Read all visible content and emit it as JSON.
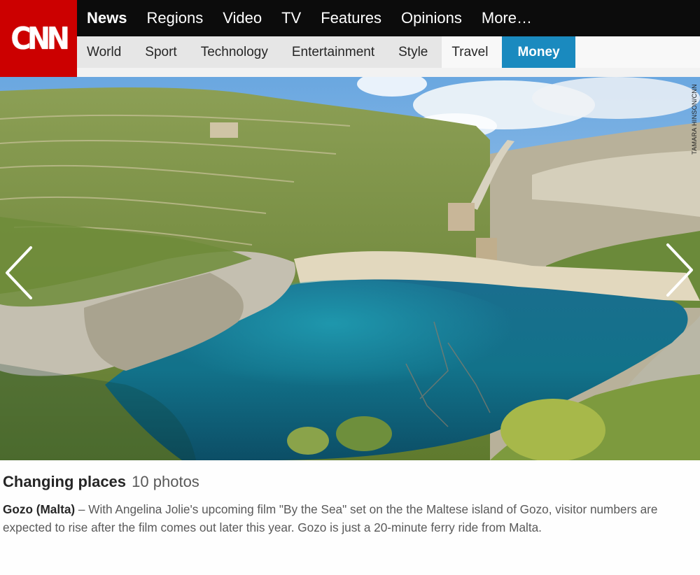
{
  "logo": {
    "text": "CNN"
  },
  "topnav": {
    "items": [
      "News",
      "Regions",
      "Video",
      "TV",
      "Features",
      "Opinions",
      "More…"
    ]
  },
  "subnav": {
    "items": [
      "World",
      "Sport",
      "Technology",
      "Entertainment",
      "Style",
      "Travel",
      "Money"
    ]
  },
  "photo": {
    "credit": "TAMARA HINSON/CNN",
    "prev_icon": "chevron-left-icon",
    "next_icon": "chevron-right-icon"
  },
  "gallery": {
    "title": "Changing places",
    "count": "10 photos"
  },
  "caption": {
    "location": "Gozo (Malta)",
    "dash": " – ",
    "text": "With Angelina Jolie's upcoming film \"By the Sea\" set on the the Maltese island of Gozo, visitor numbers are expected to rise after the film comes out later this year. Gozo is just a 20-minute ferry ride from Malta."
  },
  "colors": {
    "brand_red": "#cc0000",
    "topnav_bg": "#0c0c0c",
    "money_tab": "#1a8abf"
  }
}
